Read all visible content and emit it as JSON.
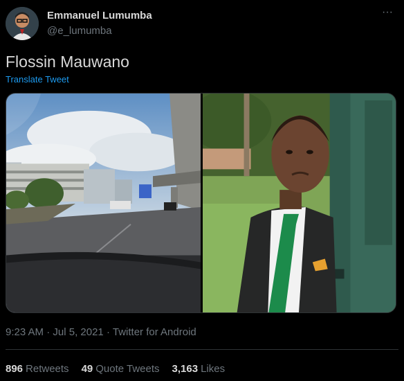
{
  "author": {
    "display_name": "Emmanuel Lumumba",
    "handle": "@e_lumumba"
  },
  "tweet": {
    "text": "Flossin Mauwano",
    "translate_label": "Translate Tweet"
  },
  "media": {
    "photos": [
      "photo-street-view",
      "photo-man-in-suit"
    ]
  },
  "meta": {
    "time": "9:23 AM",
    "separator": "·",
    "date": "Jul 5, 2021",
    "source": "Twitter for Android"
  },
  "stats": {
    "retweets_count": "896",
    "retweets_label": "Retweets",
    "quotes_count": "49",
    "quotes_label": "Quote Tweets",
    "likes_count": "3,163",
    "likes_label": "Likes"
  },
  "icons": {
    "more": "more-horizontal-icon"
  },
  "colors": {
    "background": "#000000",
    "text": "#d9d9d9",
    "secondary": "#6e767d",
    "link": "#1d9bf0",
    "border": "#2f3336"
  }
}
